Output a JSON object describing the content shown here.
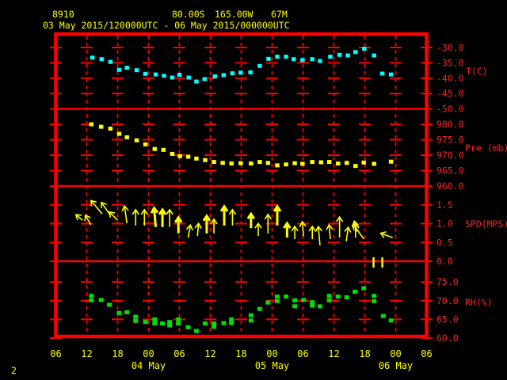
{
  "colors": {
    "background": "#000000",
    "frame": "#ff0000",
    "axis_text": "#ff2222",
    "time_text": "#ffff00",
    "temperature": "#00ffff",
    "pressure": "#ffff00",
    "wind": "#ffff00",
    "humidity": "#00e000"
  },
  "header": {
    "station_id": "8910",
    "latitude": "80.00S",
    "longitude": "165.00W",
    "elevation": "67M",
    "period": "03 May 2015/120000UTC - 06 May 2015/000000UTC"
  },
  "page_number": "2",
  "x_axis": {
    "t_unit": "hours from first x tick (06 UTC 03 May)",
    "hour_ticks": [
      {
        "hour": 0,
        "label": "06"
      },
      {
        "hour": 6,
        "label": "12"
      },
      {
        "hour": 12,
        "label": "18"
      },
      {
        "hour": 18,
        "label": "00"
      },
      {
        "hour": 24,
        "label": "06"
      },
      {
        "hour": 30,
        "label": "12"
      },
      {
        "hour": 36,
        "label": "18"
      },
      {
        "hour": 42,
        "label": "00"
      },
      {
        "hour": 48,
        "label": "06"
      },
      {
        "hour": 54,
        "label": "12"
      },
      {
        "hour": 60,
        "label": "18"
      },
      {
        "hour": 66,
        "label": "00"
      },
      {
        "hour": 72,
        "label": "06"
      }
    ],
    "date_labels": [
      {
        "hour": 18,
        "label": "04 May"
      },
      {
        "hour": 42,
        "label": "05 May"
      },
      {
        "hour": 66,
        "label": "06 May"
      }
    ]
  },
  "chart_data": [
    {
      "type": "scatter",
      "name": "temperature",
      "ylabel": "T(C)",
      "ylim": [
        -50,
        -30
      ],
      "grid": true,
      "yticks": [
        {
          "value": -30,
          "label": "-30.0"
        },
        {
          "value": -35,
          "label": "-35.0"
        },
        {
          "value": -40,
          "label": "-40.0"
        },
        {
          "value": -45,
          "label": "-45.0"
        },
        {
          "value": -50,
          "label": "-50.0"
        }
      ],
      "points_t_v": [
        [
          7.1,
          -33.3
        ],
        [
          8.9,
          -33.8
        ],
        [
          10.6,
          -34.7
        ],
        [
          12.3,
          -37.3
        ],
        [
          13.8,
          -36.6
        ],
        [
          15.7,
          -37.4
        ],
        [
          17.4,
          -38.6
        ],
        [
          19.4,
          -38.8
        ],
        [
          21.0,
          -39.2
        ],
        [
          22.6,
          -39.8
        ],
        [
          24.0,
          -38.9
        ],
        [
          25.8,
          -39.8
        ],
        [
          27.3,
          -41.1
        ],
        [
          28.9,
          -40.3
        ],
        [
          30.9,
          -39.4
        ],
        [
          32.6,
          -39.0
        ],
        [
          34.3,
          -38.4
        ],
        [
          35.9,
          -38.2
        ],
        [
          37.8,
          -38.1
        ],
        [
          39.6,
          -36.0
        ],
        [
          41.3,
          -33.7
        ],
        [
          43.0,
          -33.0
        ],
        [
          44.7,
          -33.0
        ],
        [
          46.2,
          -33.8
        ],
        [
          47.9,
          -34.1
        ],
        [
          49.8,
          -33.8
        ],
        [
          51.3,
          -34.4
        ],
        [
          53.3,
          -33.0
        ],
        [
          55.1,
          -32.4
        ],
        [
          56.7,
          -32.6
        ],
        [
          58.2,
          -31.5
        ],
        [
          59.9,
          -30.4
        ],
        [
          61.8,
          -32.6
        ],
        [
          63.4,
          -38.5
        ],
        [
          65.1,
          -38.8
        ]
      ]
    },
    {
      "type": "scatter",
      "name": "pressure",
      "ylabel": "Pre (mb)",
      "ylim": [
        960,
        985
      ],
      "grid": true,
      "yticks": [
        {
          "value": 980,
          "label": "980.0"
        },
        {
          "value": 975,
          "label": "975.0"
        },
        {
          "value": 970,
          "label": "970.0"
        },
        {
          "value": 965,
          "label": "965.0"
        },
        {
          "value": 960,
          "label": "960.0"
        }
      ],
      "points_t_v": [
        [
          6.9,
          980.0
        ],
        [
          8.8,
          979.2
        ],
        [
          10.6,
          978.6
        ],
        [
          12.3,
          976.9
        ],
        [
          13.8,
          975.8
        ],
        [
          15.7,
          974.8
        ],
        [
          17.4,
          973.5
        ],
        [
          19.2,
          972.0
        ],
        [
          20.9,
          971.7
        ],
        [
          22.6,
          970.4
        ],
        [
          24.1,
          969.7
        ],
        [
          25.7,
          969.5
        ],
        [
          27.3,
          968.9
        ],
        [
          29.0,
          968.4
        ],
        [
          30.7,
          967.8
        ],
        [
          32.4,
          967.5
        ],
        [
          34.1,
          967.3
        ],
        [
          35.9,
          967.4
        ],
        [
          37.9,
          967.3
        ],
        [
          39.6,
          967.8
        ],
        [
          41.2,
          967.5
        ],
        [
          43.0,
          966.7
        ],
        [
          44.7,
          967.0
        ],
        [
          46.4,
          967.4
        ],
        [
          47.9,
          967.2
        ],
        [
          49.8,
          967.8
        ],
        [
          51.5,
          967.7
        ],
        [
          53.1,
          967.8
        ],
        [
          54.8,
          967.3
        ],
        [
          56.5,
          967.5
        ],
        [
          58.2,
          966.5
        ],
        [
          59.8,
          967.6
        ],
        [
          61.8,
          967.2
        ],
        [
          65.1,
          967.9
        ]
      ]
    },
    {
      "type": "vector",
      "name": "wind",
      "ylabel": "SPD(MPS)",
      "ylim": [
        0,
        2
      ],
      "grid": true,
      "yticks": [
        {
          "value": 1.5,
          "label": "1.5"
        },
        {
          "value": 1.0,
          "label": "1.0"
        },
        {
          "value": 0.5,
          "label": "0.5"
        },
        {
          "value": 0.0,
          "label": "0.0"
        }
      ],
      "arrows": [
        {
          "t": 5.2,
          "spd": 1.09,
          "dir": -50,
          "len": 11,
          "bold": false
        },
        {
          "t": 6.8,
          "spd": 0.97,
          "dir": -30,
          "len": 14,
          "bold": false
        },
        {
          "t": 9.0,
          "spd": 1.26,
          "dir": -40,
          "len": 22,
          "bold": false
        },
        {
          "t": 10.6,
          "spd": 1.22,
          "dir": -35,
          "len": 20,
          "bold": false
        },
        {
          "t": 12.0,
          "spd": 1.09,
          "dir": -45,
          "len": 15,
          "bold": false
        },
        {
          "t": 13.8,
          "spd": 1.01,
          "dir": -8,
          "len": 22,
          "bold": false
        },
        {
          "t": 15.5,
          "spd": 0.95,
          "dir": 0,
          "len": 20,
          "bold": false
        },
        {
          "t": 17.2,
          "spd": 0.95,
          "dir": 0,
          "len": 20,
          "bold": false
        },
        {
          "t": 19.4,
          "spd": 0.91,
          "dir": -5,
          "len": 24,
          "bold": true
        },
        {
          "t": 20.7,
          "spd": 0.91,
          "dir": 0,
          "len": 22,
          "bold": true
        },
        {
          "t": 22.1,
          "spd": 0.91,
          "dir": 0,
          "len": 22,
          "bold": false
        },
        {
          "t": 23.8,
          "spd": 0.74,
          "dir": 0,
          "len": 20,
          "bold": true
        },
        {
          "t": 25.7,
          "spd": 0.63,
          "dir": 10,
          "len": 16,
          "bold": false
        },
        {
          "t": 27.5,
          "spd": 0.67,
          "dir": 5,
          "len": 16,
          "bold": false
        },
        {
          "t": 29.3,
          "spd": 0.74,
          "dir": 0,
          "len": 22,
          "bold": true
        },
        {
          "t": 30.7,
          "spd": 0.74,
          "dir": 0,
          "len": 18,
          "bold": false
        },
        {
          "t": 32.7,
          "spd": 0.95,
          "dir": 0,
          "len": 24,
          "bold": true
        },
        {
          "t": 34.3,
          "spd": 0.95,
          "dir": 0,
          "len": 20,
          "bold": false
        },
        {
          "t": 37.9,
          "spd": 0.88,
          "dir": 0,
          "len": 18,
          "bold": true
        },
        {
          "t": 39.3,
          "spd": 0.67,
          "dir": 0,
          "len": 16,
          "bold": false
        },
        {
          "t": 41.2,
          "spd": 0.74,
          "dir": 0,
          "len": 24,
          "bold": false
        },
        {
          "t": 43.0,
          "spd": 0.95,
          "dir": 0,
          "len": 24,
          "bold": true
        },
        {
          "t": 44.9,
          "spd": 0.63,
          "dir": 0,
          "len": 18,
          "bold": true
        },
        {
          "t": 46.4,
          "spd": 0.59,
          "dir": 0,
          "len": 16,
          "bold": false
        },
        {
          "t": 48.1,
          "spd": 0.67,
          "dir": -5,
          "len": 18,
          "bold": false
        },
        {
          "t": 49.8,
          "spd": 0.59,
          "dir": 0,
          "len": 16,
          "bold": false
        },
        {
          "t": 51.3,
          "spd": 0.42,
          "dir": -5,
          "len": 24,
          "bold": false
        },
        {
          "t": 53.3,
          "spd": 0.59,
          "dir": -5,
          "len": 18,
          "bold": false
        },
        {
          "t": 55.1,
          "spd": 0.63,
          "dir": 0,
          "len": 26,
          "bold": false
        },
        {
          "t": 56.4,
          "spd": 0.53,
          "dir": 8,
          "len": 18,
          "bold": false
        },
        {
          "t": 58.2,
          "spd": 0.63,
          "dir": 0,
          "len": 18,
          "bold": false
        },
        {
          "t": 58.4,
          "spd": 0.78,
          "dir": -12,
          "len": 14,
          "bold": false
        },
        {
          "t": 59.8,
          "spd": 0.59,
          "dir": -35,
          "len": 22,
          "bold": false
        },
        {
          "t": 65.4,
          "spd": 0.63,
          "dir": -70,
          "len": 16,
          "bold": false
        }
      ],
      "missing_markers": [
        {
          "t": 61.7
        },
        {
          "t": 63.4
        }
      ]
    },
    {
      "type": "scatter",
      "name": "relative-humidity",
      "ylabel": "RH(%)",
      "ylim": [
        60,
        80
      ],
      "grid": true,
      "yticks": [
        {
          "value": 75,
          "label": "75.0"
        },
        {
          "value": 70,
          "label": "70.0"
        },
        {
          "value": 65,
          "label": "65.0"
        },
        {
          "value": 60,
          "label": "60.0"
        }
      ],
      "points_t_v": [
        [
          6.9,
          71.3
        ],
        [
          6.9,
          70.1
        ],
        [
          8.8,
          70.2
        ],
        [
          10.4,
          68.9
        ],
        [
          12.3,
          66.7
        ],
        [
          13.8,
          66.9
        ],
        [
          15.5,
          65.7
        ],
        [
          15.5,
          64.6
        ],
        [
          17.4,
          64.3
        ],
        [
          19.2,
          65.0
        ],
        [
          19.2,
          63.9
        ],
        [
          20.7,
          63.9
        ],
        [
          22.1,
          64.3
        ],
        [
          22.1,
          63.4
        ],
        [
          23.8,
          65.0
        ],
        [
          23.8,
          63.9
        ],
        [
          25.7,
          62.9
        ],
        [
          27.3,
          61.9
        ],
        [
          29.0,
          63.9
        ],
        [
          30.7,
          63.9
        ],
        [
          30.7,
          63.0
        ],
        [
          32.6,
          64.0
        ],
        [
          34.1,
          65.0
        ],
        [
          34.1,
          64.0
        ],
        [
          37.9,
          66.1
        ],
        [
          37.9,
          64.7
        ],
        [
          39.6,
          67.8
        ],
        [
          41.2,
          69.5
        ],
        [
          43.0,
          71.1
        ],
        [
          43.0,
          69.9
        ],
        [
          44.7,
          71.1
        ],
        [
          46.4,
          70.1
        ],
        [
          46.4,
          68.5
        ],
        [
          48.1,
          70.2
        ],
        [
          49.8,
          69.6
        ],
        [
          49.8,
          68.7
        ],
        [
          51.3,
          68.5
        ],
        [
          53.1,
          71.3
        ],
        [
          53.1,
          70.1
        ],
        [
          54.8,
          71.1
        ],
        [
          56.5,
          70.9
        ],
        [
          58.1,
          72.4
        ],
        [
          59.8,
          73.3
        ],
        [
          61.8,
          71.3
        ],
        [
          61.8,
          69.9
        ],
        [
          63.6,
          65.9
        ],
        [
          65.1,
          64.7
        ]
      ]
    }
  ]
}
